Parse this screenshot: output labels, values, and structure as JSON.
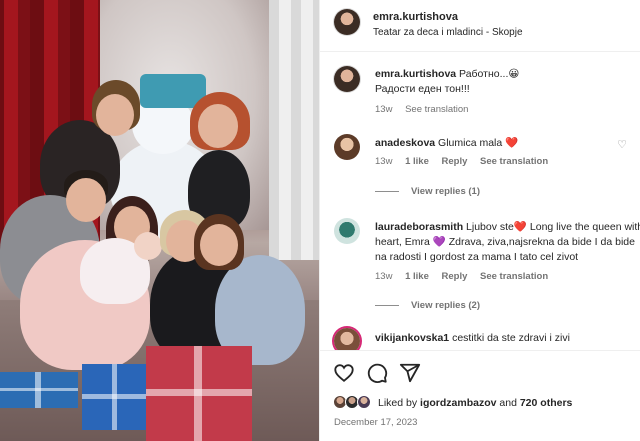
{
  "post": {
    "username": "emra.kurtishova",
    "location": "Teatar za deca i mladinci - Skopje",
    "caption_user": "emra.kurtishova",
    "caption_line1": "Работно...",
    "caption_emoji": "😀",
    "caption_line2": "Радости еден тон!!!",
    "caption_age": "13w",
    "caption_translate": "See translation"
  },
  "comments": [
    {
      "user": "anadeskova",
      "text": "Glumica mala",
      "emoji": "❤️",
      "age": "13w",
      "likes": "1 like",
      "reply": "Reply",
      "translate": "See translation",
      "view_replies": "View replies (1)"
    },
    {
      "user": "lauradeborasmith",
      "text_line1": "Ljubov ste❤️  Long live the queen with the big",
      "text_line2": "heart, Emra 💜 Zdrava, ziva,najsrekna da bide I da bide",
      "text_line3": "na radosti I gordost za mama I tato cel zivot",
      "age": "13w",
      "likes": "1 like",
      "reply": "Reply",
      "translate": "See translation",
      "view_replies": "View replies (2)"
    },
    {
      "user": "vikijankovska1",
      "text": "cestitki da ste zdravi i zivi"
    }
  ],
  "actions": {
    "like_icon": "heart-outline-icon",
    "comment_icon": "comment-bubble-icon",
    "share_icon": "paper-plane-icon"
  },
  "likes": {
    "prefix": "Liked by",
    "user": "igordzambazov",
    "and": "and",
    "others": "720 others"
  },
  "date": "December 17, 2023",
  "colors": {
    "text": "#262626",
    "secondary": "#737373",
    "heart_red": "#ed4956",
    "divider": "#efefef"
  }
}
